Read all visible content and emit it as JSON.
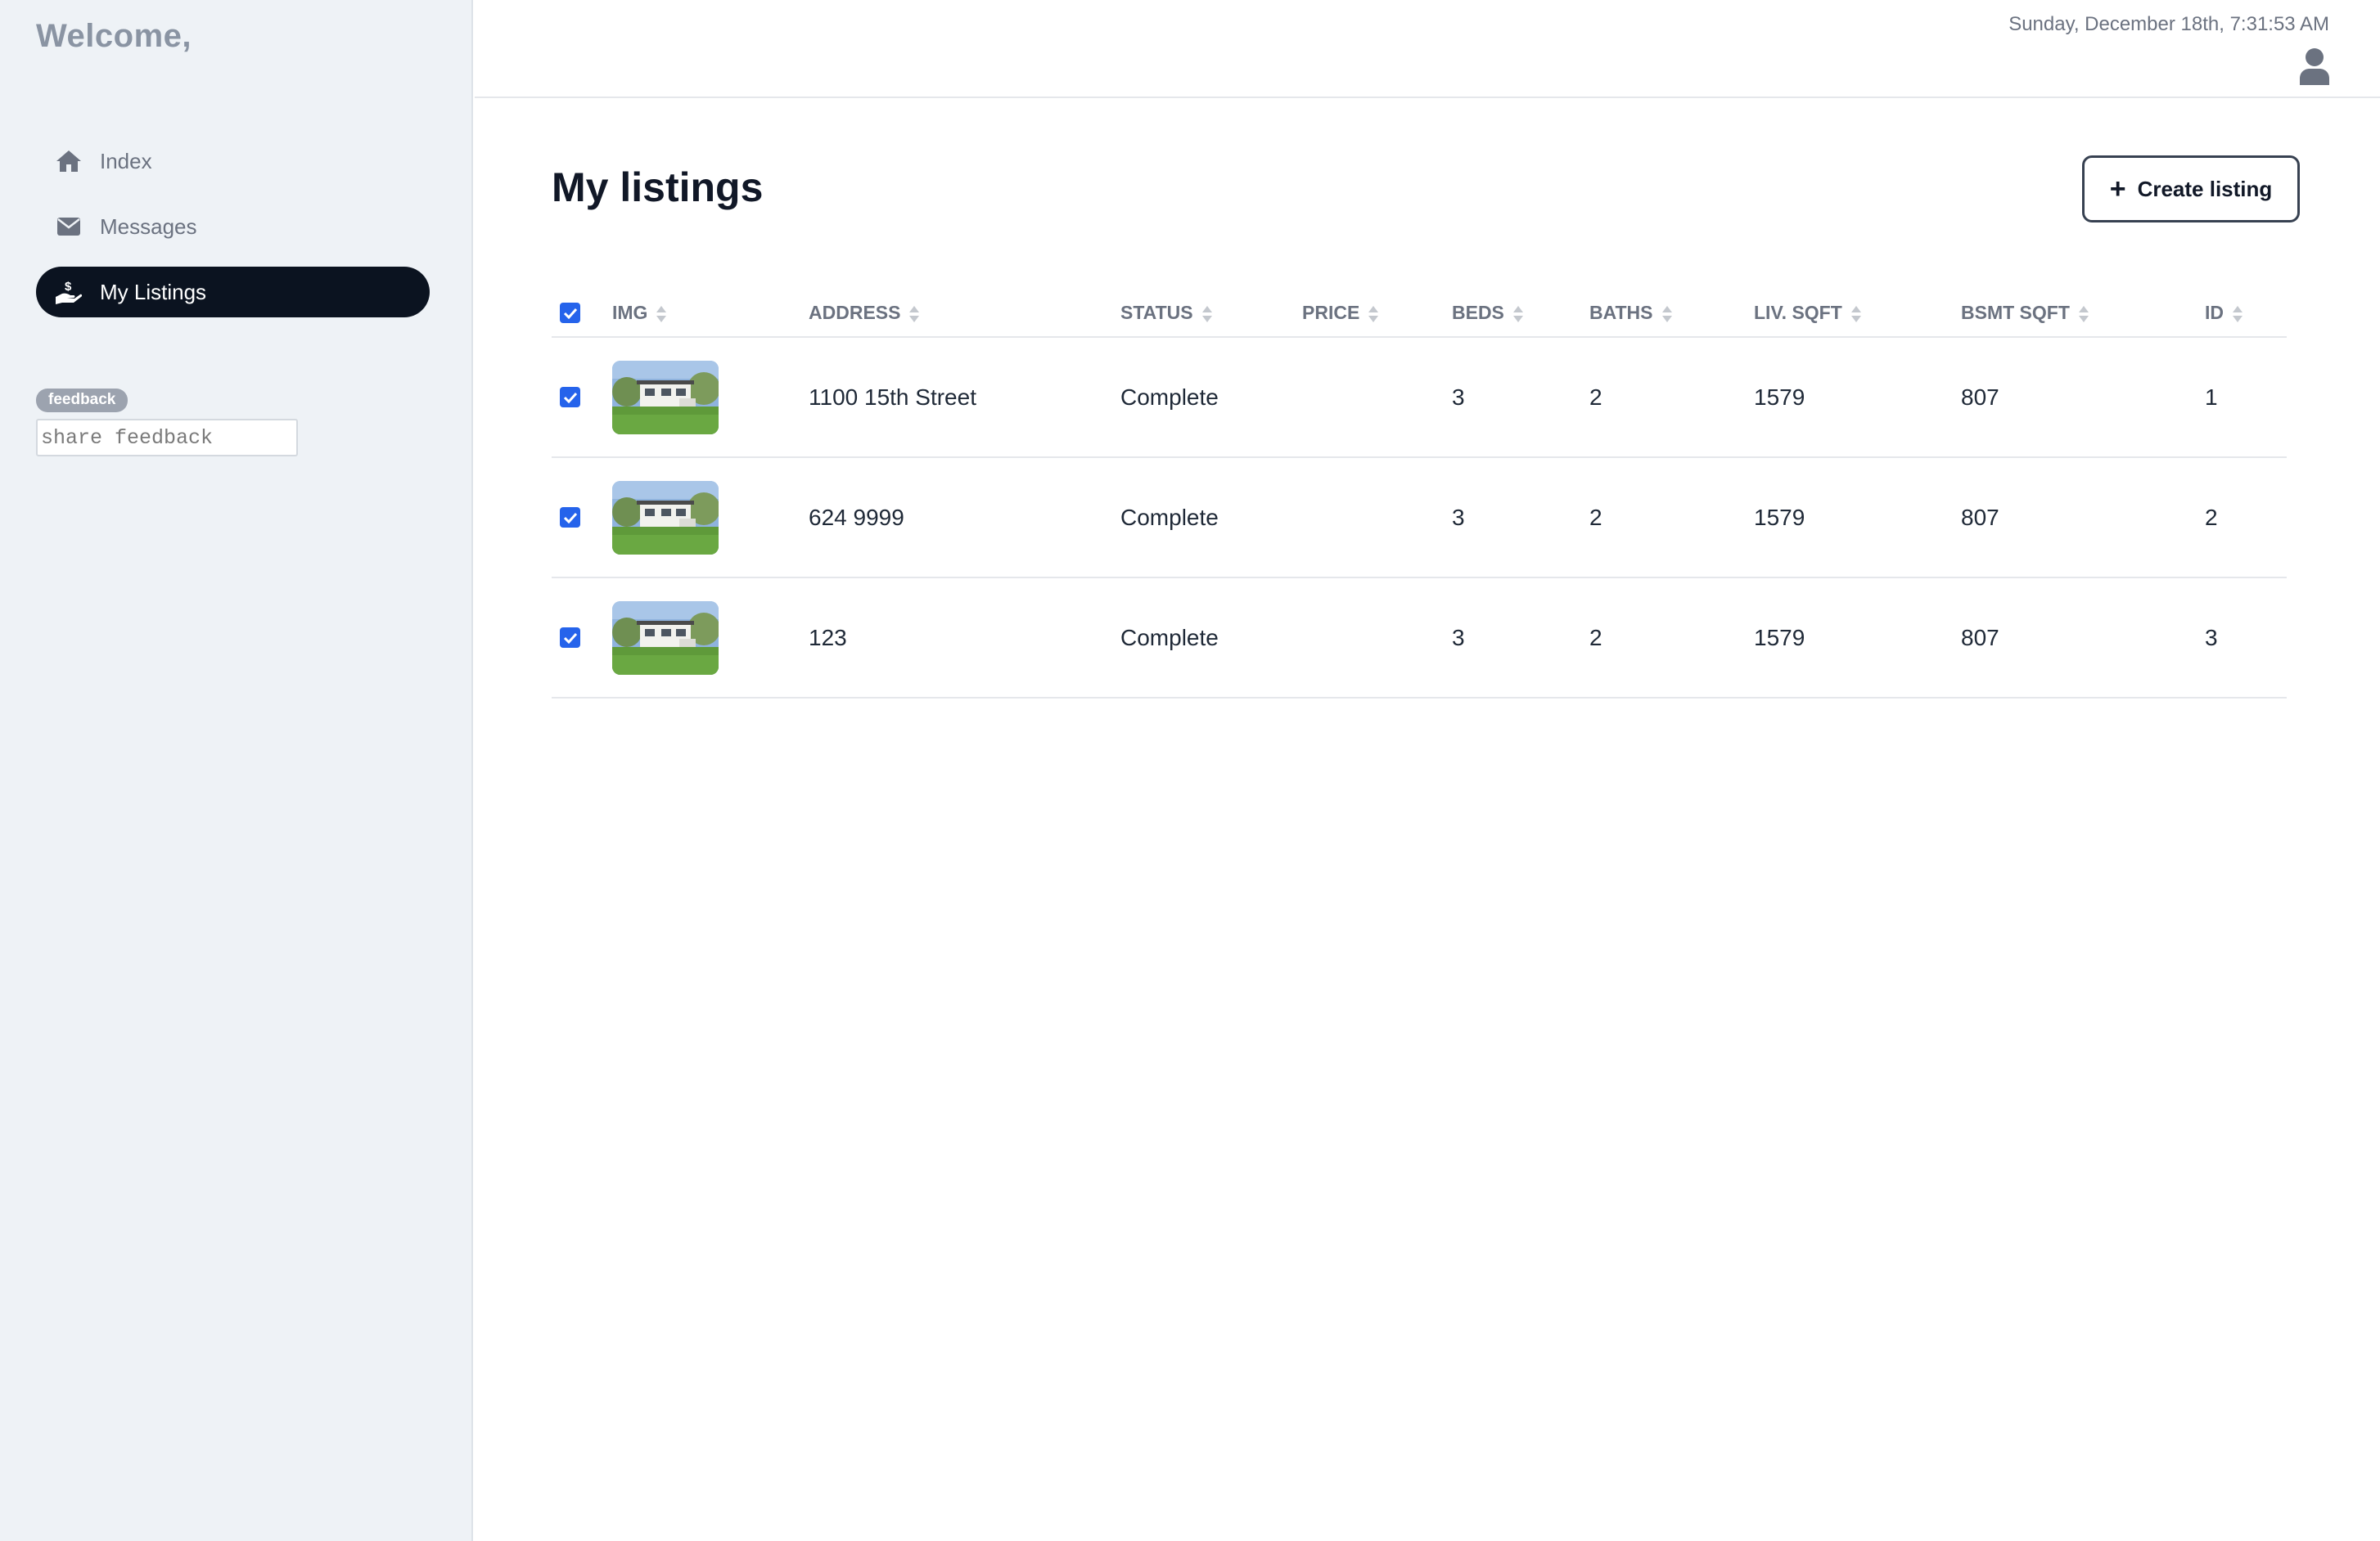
{
  "sidebar": {
    "welcome": "Welcome,",
    "items": [
      {
        "label": "Index",
        "icon": "home-icon"
      },
      {
        "label": "Messages",
        "icon": "envelope-icon"
      },
      {
        "label": "My Listings",
        "icon": "hand-dollar-icon",
        "active": true
      }
    ],
    "feedback": {
      "badge": "feedback",
      "placeholder": "share feedback"
    }
  },
  "header": {
    "datetime": "Sunday, December 18th, 7:31:53 AM",
    "user_icon": "user-icon"
  },
  "main": {
    "title": "My listings",
    "create_button": "Create listing",
    "table": {
      "columns": [
        "IMG",
        "ADDRESS",
        "STATUS",
        "PRICE",
        "BEDS",
        "BATHS",
        "LIV. SQFT",
        "BSMT SQFT",
        "ID"
      ],
      "rows": [
        {
          "address": "1100 15th Street",
          "status": "Complete",
          "price": "",
          "beds": "3",
          "baths": "2",
          "liv_sqft": "1579",
          "bsmt_sqft": "807",
          "id": "1"
        },
        {
          "address": "624 9999",
          "status": "Complete",
          "price": "",
          "beds": "3",
          "baths": "2",
          "liv_sqft": "1579",
          "bsmt_sqft": "807",
          "id": "2"
        },
        {
          "address": "123",
          "status": "Complete",
          "price": "",
          "beds": "3",
          "baths": "2",
          "liv_sqft": "1579",
          "bsmt_sqft": "807",
          "id": "3"
        }
      ]
    }
  },
  "colors": {
    "sidebar_bg": "#eef2f6",
    "active_nav_bg": "#0b1320",
    "checkbox": "#2563eb",
    "muted_text": "#6b7280"
  }
}
